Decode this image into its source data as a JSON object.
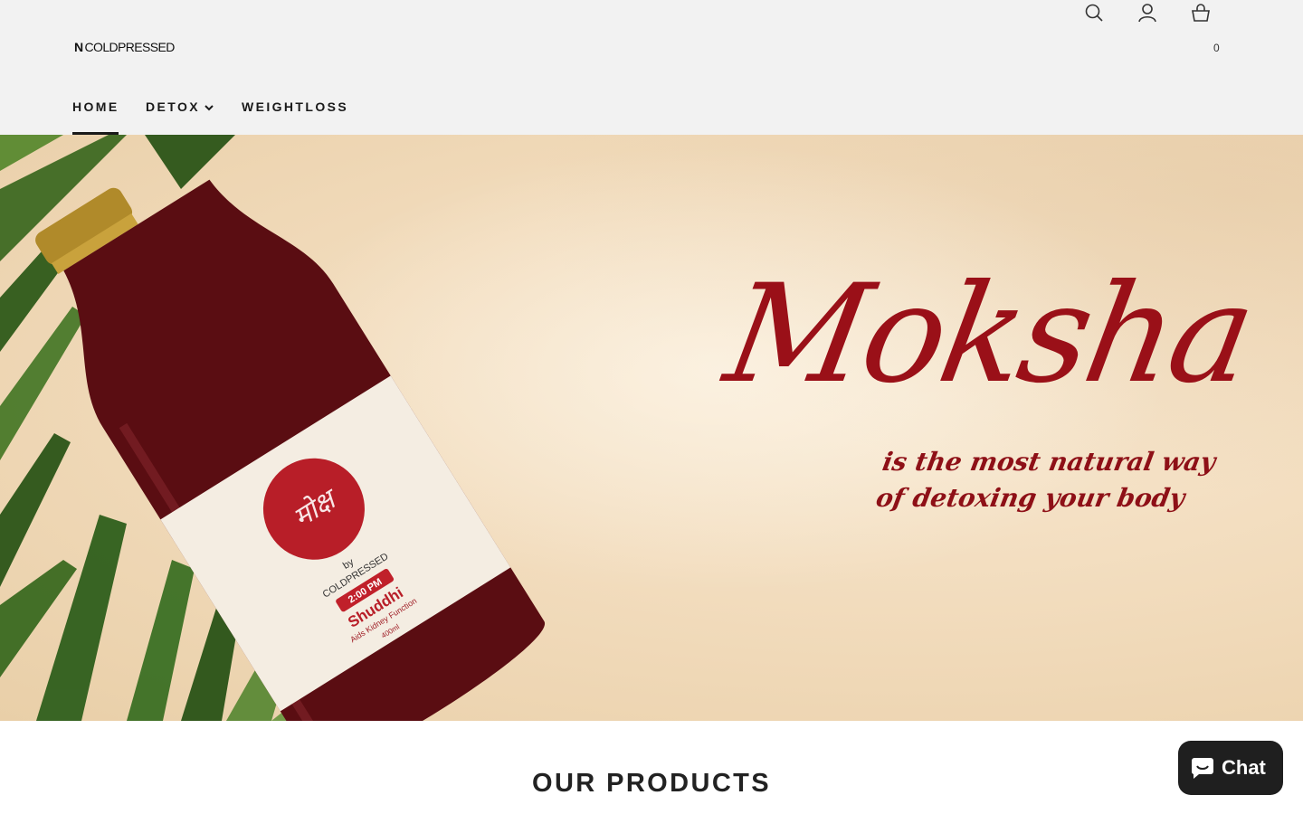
{
  "header": {
    "logo_mark": "N",
    "logo_text": "COLDPRESSED",
    "cart_count": "0",
    "icons": [
      "search-icon",
      "account-icon",
      "cart-icon"
    ]
  },
  "nav": {
    "items": [
      {
        "label": "HOME",
        "active": true
      },
      {
        "label": "DETOX",
        "has_dropdown": true
      },
      {
        "label": "WEIGHTLOSS"
      }
    ]
  },
  "hero": {
    "title": "Moksha",
    "tagline_line1": "is the most natural way",
    "tagline_line2": "of detoxing your body",
    "bottle_label": {
      "by": "by",
      "brand": "COLDPRESSED",
      "time": "2:00 PM",
      "name": "Shuddhi",
      "sub": "Aids Kidney Function",
      "volume": "400ml"
    }
  },
  "products": {
    "title": "OUR PRODUCTS"
  },
  "chat": {
    "label": "Chat"
  },
  "colors": {
    "header_bg": "#f2f2f2",
    "accent_red": "#9a1018",
    "chat_bg": "#1f1f1f"
  }
}
